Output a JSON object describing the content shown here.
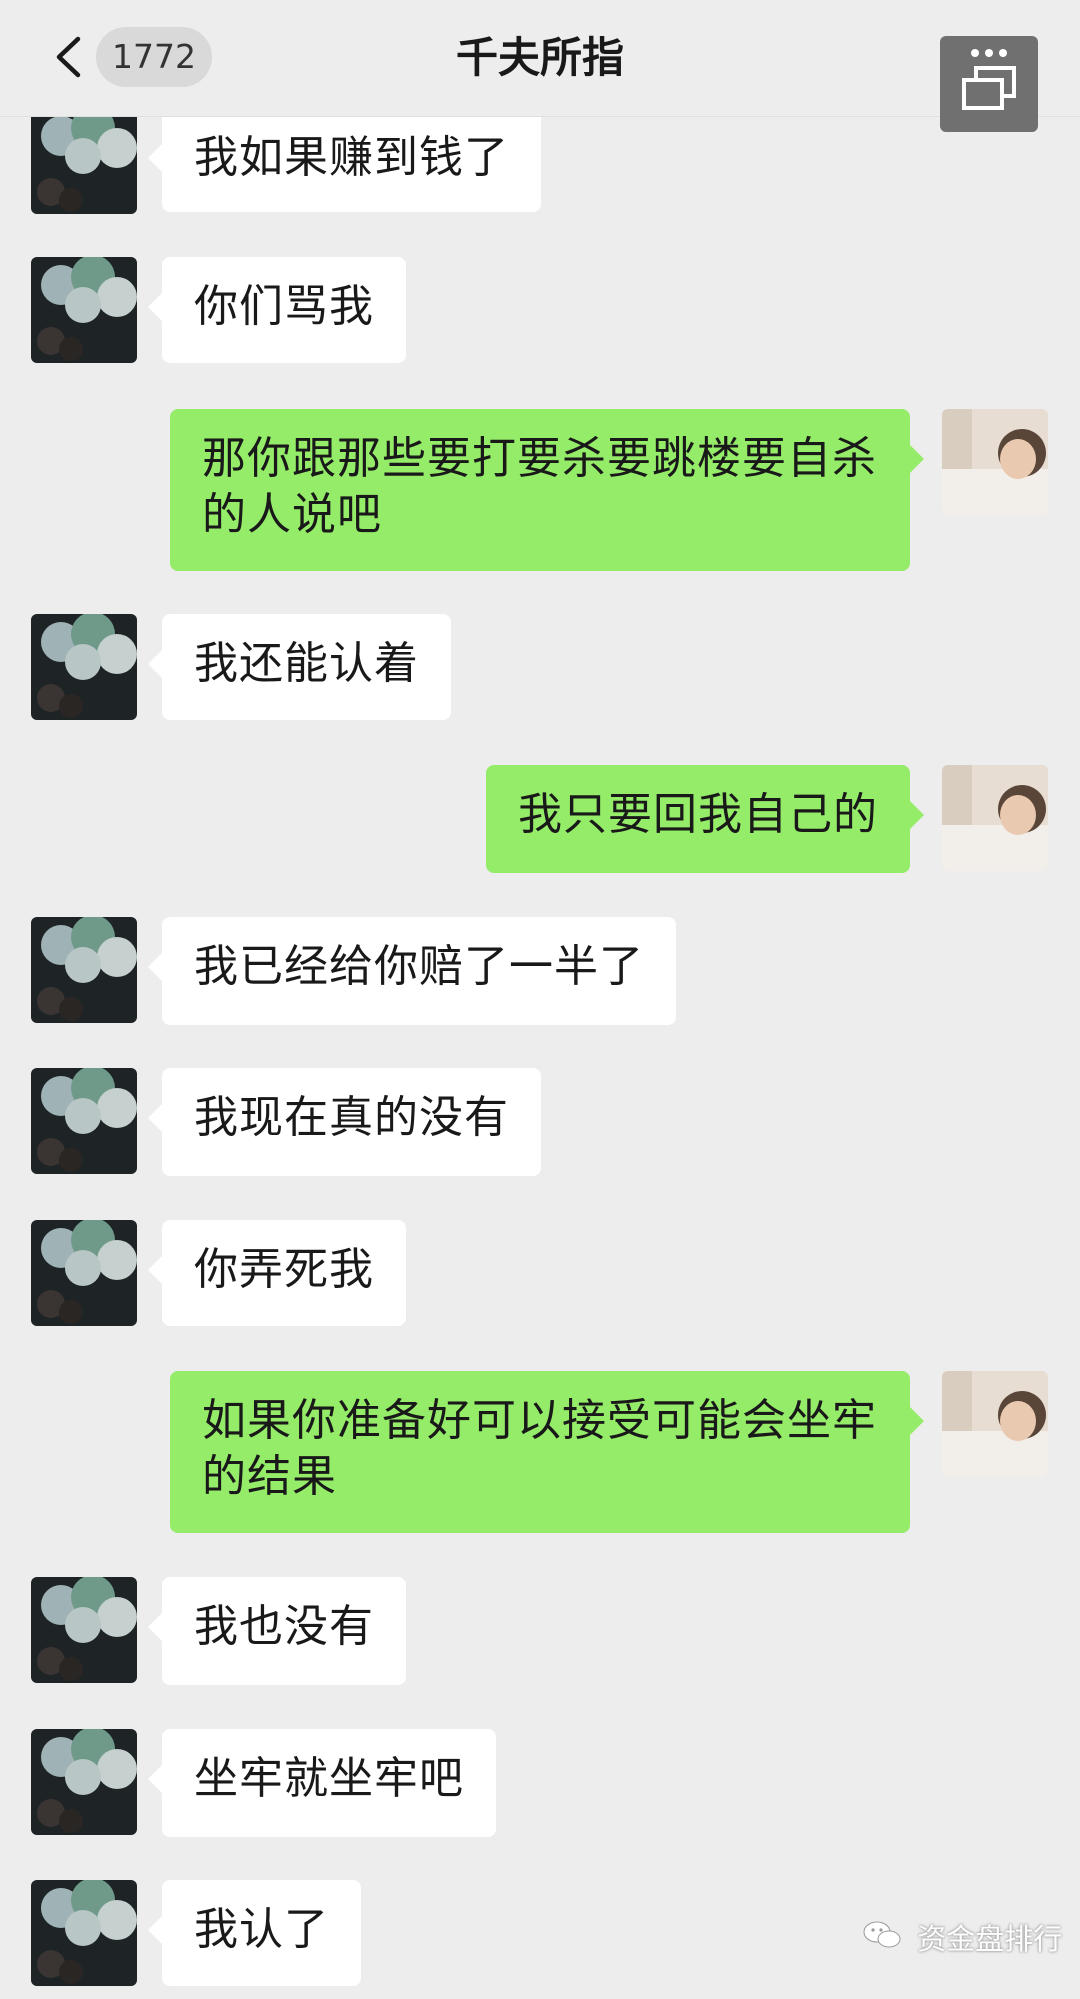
{
  "header": {
    "unread_count": "1772",
    "title": "千夫所指",
    "back_icon": "chevron-left-icon",
    "more_icon": "more-options-icon"
  },
  "colors": {
    "background": "#ededed",
    "sent_bubble": "#95ec69",
    "received_bubble": "#ffffff"
  },
  "messages": [
    {
      "side": "received",
      "text": "我如果赚到钱了"
    },
    {
      "side": "received",
      "text": "你们骂我"
    },
    {
      "side": "sent",
      "text": "那你跟那些要打要杀要跳楼要自杀的人说吧"
    },
    {
      "side": "received",
      "text": "我还能认着"
    },
    {
      "side": "sent",
      "text": "我只要回我自己的"
    },
    {
      "side": "received",
      "text": "我已经给你赔了一半了"
    },
    {
      "side": "received",
      "text": "我现在真的没有"
    },
    {
      "side": "received",
      "text": "你弄死我"
    },
    {
      "side": "sent",
      "text": "如果你准备好可以接受可能会坐牢的结果"
    },
    {
      "side": "received",
      "text": "我也没有"
    },
    {
      "side": "received",
      "text": "坐牢就坐牢吧"
    },
    {
      "side": "received",
      "text": "我认了"
    }
  ],
  "watermark": {
    "text": "资金盘排行",
    "icon": "wechat-official-account-icon"
  }
}
